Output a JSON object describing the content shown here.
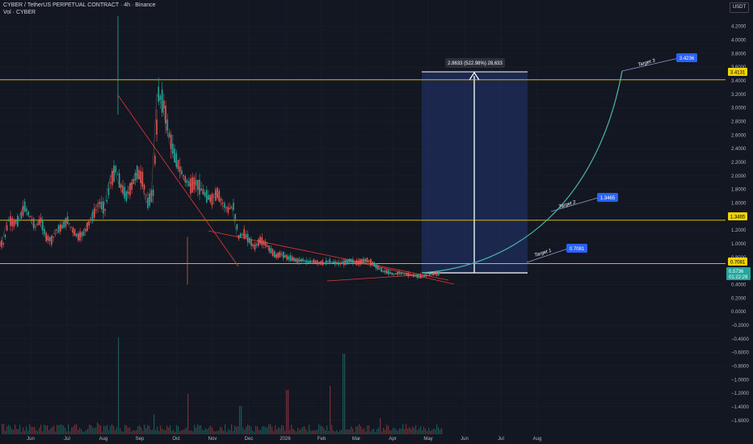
{
  "header": {
    "symbol_line": "CYBER / TetherUS PERPETUAL CONTRACT · 4h · Binance",
    "volume_line": "Vol · CYBER"
  },
  "currency_button": "USDT",
  "price_tags": {
    "level_top": "3.4131",
    "level_mid": "1.3465",
    "level_low": "0.7081",
    "last_price": "0.5736",
    "countdown": "01:22:29"
  },
  "measure_label": "2.8633 (522.98%) 28,633",
  "targets": [
    {
      "label": "Target 1",
      "value": "0.7081"
    },
    {
      "label": "Target 2",
      "value": "1.3465"
    },
    {
      "label": "Target 3",
      "value": "3.4236"
    }
  ],
  "colors": {
    "background": "#131722",
    "up": "#26a69a",
    "down": "#ef5350",
    "level_line": "#f0d300",
    "trendline": "#e53935",
    "measure_box": "#1e2a55",
    "target_curve": "#4db6ac",
    "target_badge": "#2962ff",
    "last_price_badge": "#26a69a"
  },
  "chart_data": {
    "type": "line",
    "x": [
      "Jun",
      "Jul",
      "Aug",
      "Sep",
      "Oct",
      "Nov",
      "Dec",
      "2026",
      "Feb",
      "Mar",
      "Apr",
      "May",
      "Jun",
      "Jul",
      "Aug"
    ],
    "y_ticks": [
      "4.2000",
      "4.0000",
      "3.8000",
      "3.6000",
      "3.4000",
      "3.2000",
      "3.0000",
      "2.8000",
      "2.6000",
      "2.4000",
      "2.2000",
      "2.0000",
      "1.8000",
      "1.6000",
      "1.4000",
      "1.2000",
      "1.0000",
      "0.8000",
      "0.6000",
      "0.4000",
      "0.2000",
      "0.0000",
      "−0.2000",
      "−0.4000",
      "−0.6000",
      "−0.8000",
      "−1.0000",
      "−1.2000",
      "−1.4000",
      "−1.6000"
    ],
    "ylim": [
      -1.65,
      4.35
    ],
    "series": [
      {
        "values": [
          1.0,
          1.35,
          1.3,
          1.35,
          1.55,
          1.4,
          1.25,
          1.35,
          1.1,
          1.05,
          1.2,
          1.25,
          1.35,
          1.2,
          1.1,
          1.15,
          1.3,
          1.45,
          1.6,
          1.5,
          1.9,
          2.1,
          1.85,
          1.7,
          1.85,
          2.05,
          1.95,
          1.6,
          1.75,
          3.2,
          3.05,
          2.6,
          2.3,
          2.1,
          1.95,
          1.85,
          1.9,
          1.8,
          1.7,
          1.65,
          1.75,
          1.6,
          1.5,
          1.55,
          1.1,
          1.15,
          1.05,
          0.95,
          1.05,
          1.0,
          0.9,
          0.82,
          0.85,
          0.8,
          0.78,
          0.75,
          0.76,
          0.73,
          0.74,
          0.72,
          0.72,
          0.74,
          0.72,
          0.71,
          0.73,
          0.75,
          0.72,
          0.74,
          0.76,
          0.72,
          0.65,
          0.6,
          0.58,
          0.55,
          0.57,
          0.56,
          0.54,
          0.53,
          0.52,
          0.53,
          0.55,
          0.56,
          0.57
        ]
      }
    ],
    "levels": [
      3.4131,
      1.3465,
      0.7081
    ],
    "last_price": 0.5736,
    "measure": {
      "from": 0.55,
      "to": 3.4131,
      "text": "2.8633 (522.98%) 28,633"
    },
    "targets": [
      0.7081,
      1.3465,
      3.4236
    ]
  }
}
